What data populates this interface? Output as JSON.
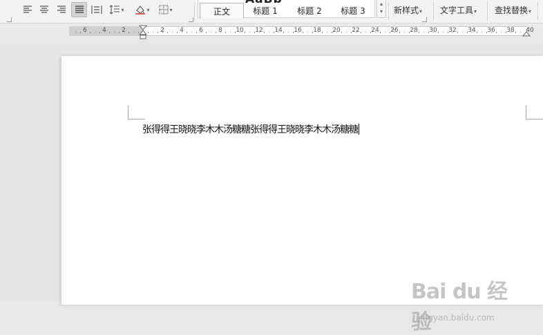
{
  "ribbon": {
    "styles": {
      "preview_text": "AaBb",
      "items": [
        {
          "label": "正文",
          "selected": true
        },
        {
          "label": "标题 1"
        },
        {
          "label": "标题 2"
        },
        {
          "label": "标题 3"
        }
      ]
    },
    "new_style_label": "新样式",
    "text_tools_label": "文字工具",
    "find_replace_label": "查找替换",
    "icons": {
      "align_left": "align-left-icon",
      "align_center": "align-center-icon",
      "align_right": "align-right-icon",
      "justify": "justify-icon",
      "distributed": "distributed-align-icon",
      "line_spacing": "line-spacing-icon",
      "shading": "shading-icon",
      "borders": "borders-icon"
    }
  },
  "ruler": {
    "labels": [
      "6",
      "4",
      "2",
      "2",
      "4",
      "6",
      "8",
      "10",
      "12",
      "14",
      "16",
      "18",
      "20",
      "22",
      "24",
      "26",
      "28",
      "30",
      "32",
      "34",
      "36",
      "38",
      "40"
    ]
  },
  "document": {
    "text": "张得得王晓晓李木木汤糖糖张得得王晓晓李木木汤糖糖"
  },
  "watermark": {
    "main": "Bai du 经验",
    "sub": "jingyan.baidu.com"
  },
  "colors": {
    "ribbon_bg": "#f3f3f3",
    "page_bg": "#ffffff",
    "workspace_bg": "#e6e6e6"
  }
}
